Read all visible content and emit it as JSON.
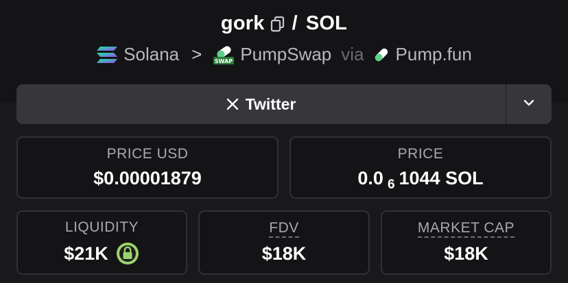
{
  "header": {
    "token_name": "gork",
    "separator": "/",
    "quote_symbol": "SOL",
    "chain_name": "Solana",
    "chevron": ">",
    "dex_name": "PumpSwap",
    "dex_badge": "SWAP",
    "via": "via",
    "launchpad_name": "Pump.fun"
  },
  "social": {
    "label": "Twitter",
    "icon": "x-logo-icon",
    "more_icon": "chevron-down-icon"
  },
  "stats": {
    "price_usd": {
      "label": "PRICE USD",
      "value": "$0.00001879"
    },
    "price": {
      "label": "PRICE",
      "value_prefix": "0.0",
      "value_subscript": "6",
      "value_suffix": "1044 SOL"
    },
    "liquidity": {
      "label": "LIQUIDITY",
      "value": "$21K",
      "lock_icon": "lock-icon"
    },
    "fdv": {
      "label": "FDV",
      "value": "$18K"
    },
    "market_cap": {
      "label": "MARKET CAP",
      "value": "$18K"
    }
  },
  "colors": {
    "background": "#19191c",
    "card_border": "#303036",
    "button_bg": "#36363b",
    "lock_green": "#9bd36b",
    "solana_purple": "#9945ff",
    "solana_green": "#14f195"
  }
}
